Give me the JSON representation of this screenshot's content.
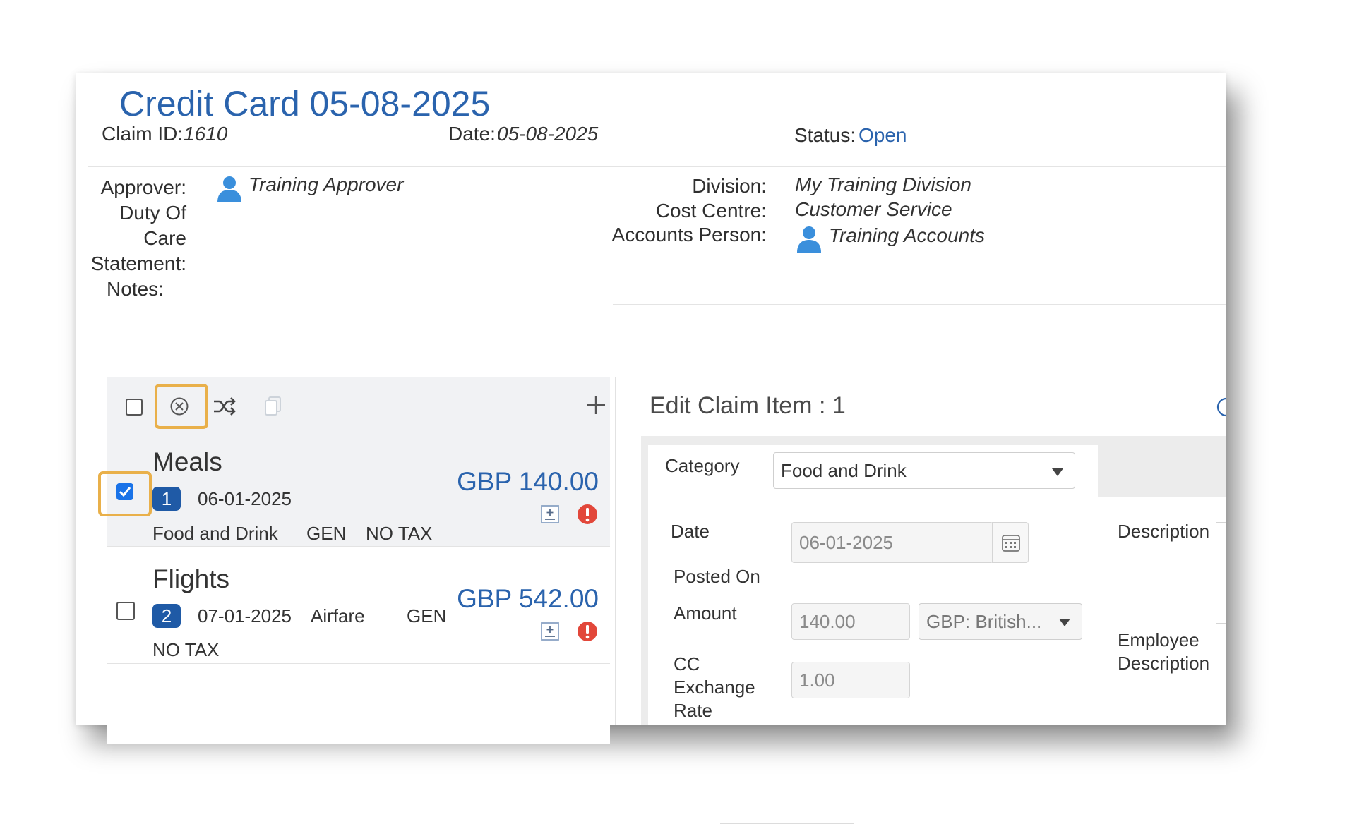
{
  "claim": {
    "title": "Credit Card 05-08-2025",
    "claim_id_label": "Claim ID:",
    "claim_id": "1610",
    "date_label": "Date:",
    "date": "05-08-2025",
    "status_label": "Status:",
    "status": "Open"
  },
  "details": {
    "approver_label": "Approver:",
    "approver": "Training Approver",
    "duty_label_1": "Duty Of",
    "duty_label_2": "Care",
    "duty_label_3": "Statement:",
    "notes_label": "Notes:",
    "division_label": "Division:",
    "division": "My Training Division",
    "cost_centre_label": "Cost Centre:",
    "cost_centre": "Customer Service",
    "accounts_label": "Accounts Person:",
    "accounts": "Training Accounts"
  },
  "items": [
    {
      "name": "Meals",
      "number": "1",
      "date": "06-01-2025",
      "category": "Food and Drink",
      "tax_code": "GEN",
      "tax": "NO TAX",
      "amount": "GBP 140.00",
      "checked": true
    },
    {
      "name": "Flights",
      "number": "2",
      "date": "07-01-2025",
      "category": "Airfare",
      "tax_code": "GEN",
      "tax": "NO TAX",
      "amount": "GBP 542.00",
      "checked": false
    }
  ],
  "toolbar": {
    "add_glyph": "+",
    "icons": [
      "select-all-checkbox",
      "remove-circle-icon",
      "shuffle-icon",
      "copy-icon",
      "plus-icon"
    ]
  },
  "edit": {
    "title": "Edit Claim Item : 1",
    "category_label": "Category",
    "category_value": "Food and Drink",
    "date_label": "Date",
    "date_value": "06-01-2025",
    "posted_on_label": "Posted On",
    "amount_label": "Amount",
    "amount_value": "140.00",
    "currency_value": "GBP: British...",
    "cc_rate_label_1": "CC",
    "cc_rate_label_2": "Exchange",
    "cc_rate_label_3": "Rate",
    "cc_rate_value": "1.00",
    "description_label": "Description",
    "employee_desc_label_1": "Employee",
    "employee_desc_label_2": "Description"
  },
  "colors": {
    "accent_blue": "#2a63ad",
    "badge_blue": "#1f5aa6",
    "highlight": "#e9b04a",
    "error_red": "#e2473a"
  }
}
